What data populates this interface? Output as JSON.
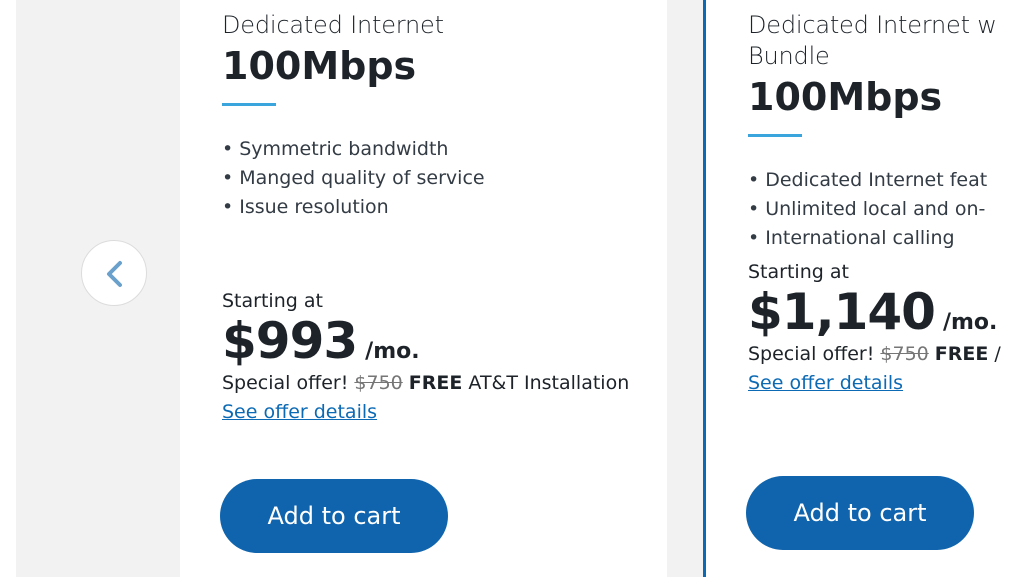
{
  "carousel": {
    "prev_icon": "chevron-left-icon"
  },
  "colors": {
    "accent_bar": "#3aa5dc",
    "button_bg": "#0f64ad",
    "link": "#0c6ab4",
    "selected_border": "#0c6ab4",
    "page_bg": "#f2f2f2"
  },
  "plans": [
    {
      "name": "Dedicated Internet",
      "speed": "100Mbps",
      "features": [
        "Symmetric bandwidth",
        "Manged quality of service",
        "Issue resolution"
      ],
      "starting_label": "Starting at",
      "price": "$993",
      "per": "/mo.",
      "offer_prefix": "Special offer!",
      "offer_strike": "$750",
      "offer_free": "FREE",
      "offer_suffix": "AT&T Installation",
      "details_link": "See offer details",
      "cart_button": "Add to cart"
    },
    {
      "name": "Dedicated Internet w",
      "name_line2": "Bundle",
      "speed": "100Mbps",
      "features": [
        "Dedicated Internet feat",
        "Unlimited local and on-",
        "International calling"
      ],
      "starting_label": "Starting at",
      "price": "$1,140",
      "per": "/mo.",
      "offer_prefix": "Special offer!",
      "offer_strike": "$750",
      "offer_free": "FREE",
      "offer_suffix": "/",
      "details_link": "See offer details",
      "cart_button": "Add to cart",
      "selected": true
    }
  ]
}
